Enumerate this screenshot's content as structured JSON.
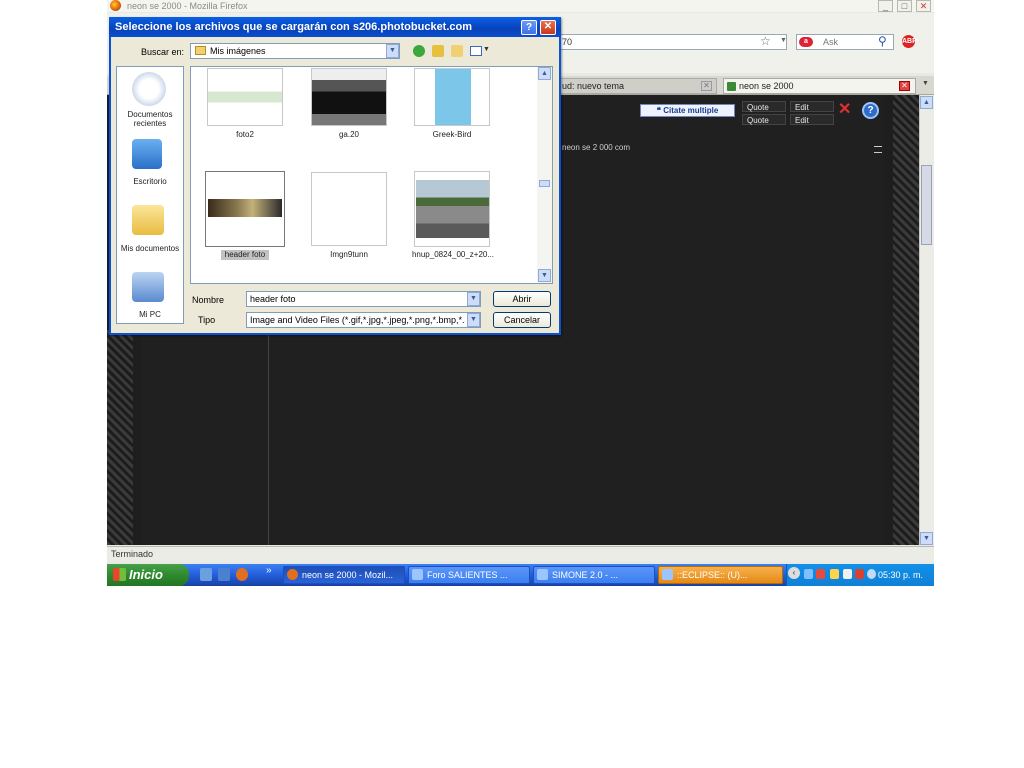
{
  "browser": {
    "title": "neon se 2000 - Mozilla Firefox",
    "url_fragment": "70",
    "search_placeholder": "Ask",
    "tabs": [
      {
        "label": "ud: nuevo tema"
      },
      {
        "label": "neon se 2000"
      }
    ],
    "status": "Terminado"
  },
  "page": {
    "multi_quote": "Citate multiple",
    "quote_label": "Quote",
    "edit_label": "Edit",
    "text_line": "neon se 2 000 com"
  },
  "dialog": {
    "title": "Seleccione los archivos que se cargarán con s206.photobucket.com",
    "look_in_label": "Buscar en:",
    "look_in_value": "Mis imágenes",
    "places": [
      {
        "label": "Documentos recientes",
        "icon": "recent-documents-icon"
      },
      {
        "label": "Escritorio",
        "icon": "desktop-icon"
      },
      {
        "label": "Mis documentos",
        "icon": "my-documents-icon"
      },
      {
        "label": "Mi PC",
        "icon": "my-computer-icon"
      }
    ],
    "files": [
      {
        "label": "foto2",
        "selected": false
      },
      {
        "label": "ga.20",
        "selected": false
      },
      {
        "label": "Greek-Bird",
        "selected": false
      },
      {
        "label": "header foto",
        "selected": true
      },
      {
        "label": "Imgn9tunn",
        "selected": false
      },
      {
        "label": "hnup_0824_00_z+20...",
        "selected": false
      }
    ],
    "name_label": "Nombre",
    "name_value": "header foto",
    "type_label": "Tipo",
    "type_value": "Image and Video Files (*.gif,*.jpg,*.jpeg,*.png,*.bmp,*.swf)",
    "open_button": "Abrir",
    "cancel_button": "Cancelar"
  },
  "taskbar": {
    "start_label": "Inicio",
    "tasks": [
      {
        "label": "neon se 2000 - Mozil..."
      },
      {
        "label": "Foro SALIENTES ..."
      },
      {
        "label": "SIMONE 2.0 - ..."
      },
      {
        "label": "::ECLIPSE:: (U)..."
      }
    ],
    "clock": "05:30 p. m."
  }
}
